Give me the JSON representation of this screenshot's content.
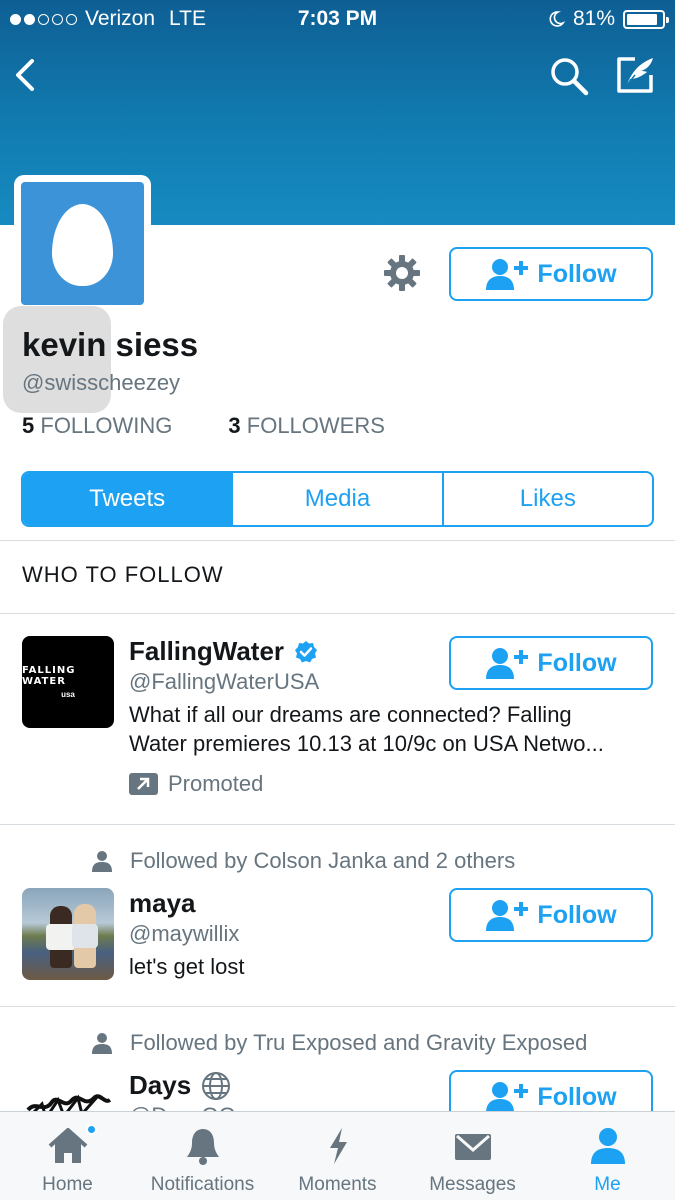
{
  "status_bar": {
    "signal_dots": 5,
    "signal_filled": 2,
    "carrier": "Verizon",
    "network": "LTE",
    "time": "7:03 PM",
    "battery": "81%",
    "battery_level": 0.81
  },
  "nav": {
    "back_icon": "back-chevron-icon",
    "search_icon": "search-icon",
    "compose_icon": "compose-tweet-icon"
  },
  "profile": {
    "name": "kevin siess",
    "handle": "@swisscheezey",
    "following_count": "5",
    "following_label": "FOLLOWING",
    "followers_count": "3",
    "followers_label": "FOLLOWERS",
    "follow_label": "Follow"
  },
  "tabs": [
    {
      "label": "Tweets",
      "active": true
    },
    {
      "label": "Media",
      "active": false
    },
    {
      "label": "Likes",
      "active": false
    }
  ],
  "who_to_follow": {
    "title": "WHO TO FOLLOW",
    "accounts": [
      {
        "name": "FallingWater",
        "verified": true,
        "handle": "@FallingWaterUSA",
        "bio_line1": "What if all our dreams are connected? Falling",
        "bio_line2": "Water premieres 10.13 at 10/9c on USA Netwo...",
        "promoted_label": "Promoted",
        "avatar_text": "FALLING WATER",
        "avatar_logo": "usa",
        "follow_label": "Follow"
      },
      {
        "social_context": "Followed by Colson Janka and 2 others",
        "name": "maya",
        "handle": "@maywillix",
        "bio": "let's get lost",
        "follow_label": "Follow"
      },
      {
        "social_context": "Followed by Tru Exposed and Gravity Exposed",
        "name": "Days",
        "handle": "@DaysOG",
        "follow_label": "Follow"
      }
    ]
  },
  "tab_bar": [
    {
      "label": "Home",
      "icon": "home-icon",
      "active": false,
      "has_badge": true
    },
    {
      "label": "Notifications",
      "icon": "bell-icon",
      "active": false
    },
    {
      "label": "Moments",
      "icon": "lightning-icon",
      "active": false
    },
    {
      "label": "Messages",
      "icon": "envelope-icon",
      "active": false
    },
    {
      "label": "Me",
      "icon": "person-icon",
      "active": true
    }
  ],
  "colors": {
    "accent": "#1da1f2",
    "banner": "#117bb0",
    "avatar_bg": "#3d93d8",
    "muted_text": "#66757f"
  }
}
